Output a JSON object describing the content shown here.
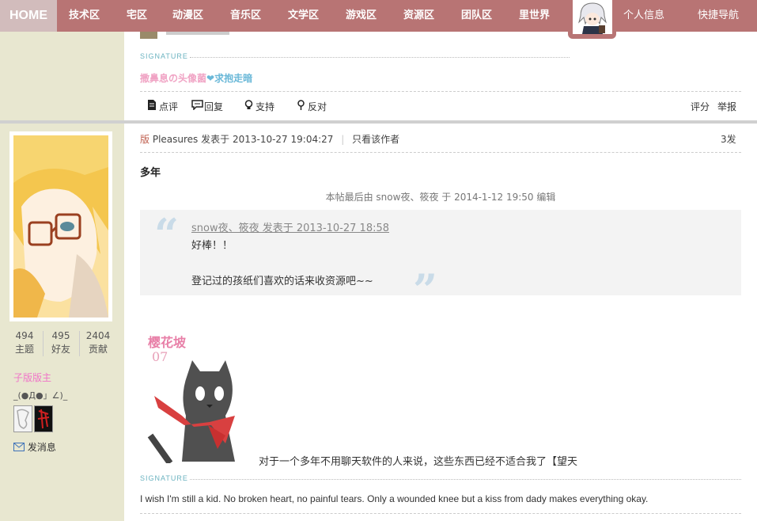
{
  "nav": {
    "home": "HOME",
    "items": [
      "技术区",
      "宅区",
      "动漫区",
      "音乐区",
      "文学区",
      "游戏区",
      "资源区",
      "团队区",
      "里世界"
    ],
    "profile": "个人信息",
    "quick_nav": "快捷导航"
  },
  "prev_post": {
    "signature_label": "SIGNATURE",
    "signature_pink": "撒鼻息の头像菌",
    "signature_heart": "❤",
    "signature_blue": "求抱走暗",
    "actions": [
      "点评",
      "回复",
      "支持",
      "反对"
    ],
    "right_actions": [
      "评分",
      "举报"
    ]
  },
  "user": {
    "stats": [
      {
        "value": "494",
        "label": "主题"
      },
      {
        "value": "495",
        "label": "好友"
      },
      {
        "value": "2404",
        "label": "贡献"
      }
    ],
    "group": "子版版主",
    "kaomoji": "_(●Д●」∠)_",
    "message_link": "发消息"
  },
  "post": {
    "badge": "版",
    "author": "Pleasures",
    "posted_at": "发表于 2013-10-27 19:04:27",
    "only_author": "只看该作者",
    "floor": "3发",
    "title": "多年",
    "edit_note": "本帖最后由 snow夜、筱夜 于 2014-1-12 19:50 编辑",
    "quote": {
      "header": "snow夜、筱夜 发表于 2013-10-27 18:58",
      "line1": "好棒！！",
      "line2": "登记过的孩纸们喜欢的话来收资源吧~~"
    },
    "image_caption_1": "樱花坡",
    "image_caption_2": "07",
    "body_text": "对于一个多年不用聊天软件的人来说，这些东西已经不适合我了【望天",
    "signature_label": "SIGNATURE",
    "signature_text": "I wish I'm still a kid. No broken heart, no painful tears. Only a wounded knee but a kiss from dady makes everything okay."
  },
  "colors": {
    "nav_bg": "#b87474",
    "home_bg": "#d2bcbc",
    "sidebar_bg": "#e8e7d0",
    "signature_label": "#6bb3c0",
    "pink": "#f0a3c4",
    "blue_text": "#6ab8d8",
    "group_pink": "#f075c8"
  }
}
